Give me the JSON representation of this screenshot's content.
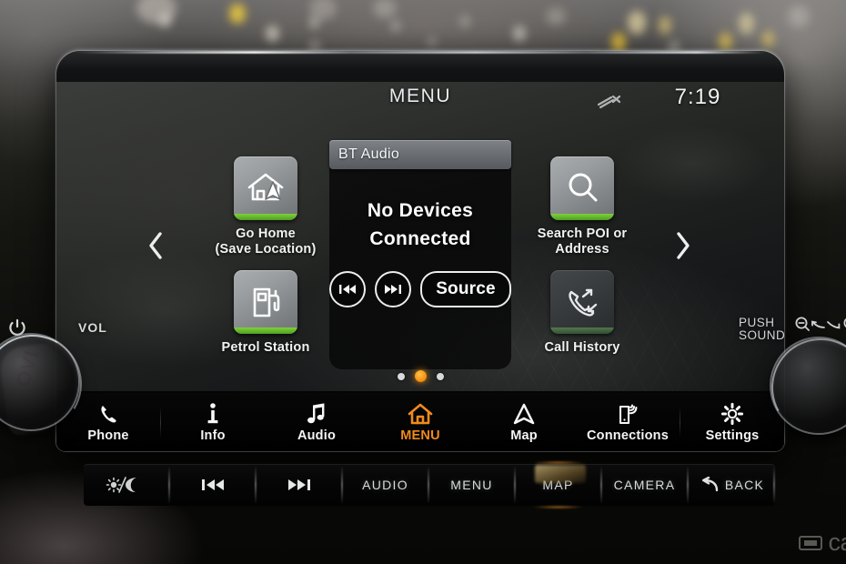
{
  "status_bar": {
    "title": "MENU",
    "mute_icon": "audio-muted-icon",
    "clock": "7:19"
  },
  "colors": {
    "accent_green": "#5CB82E",
    "active_orange": "#F08A1E",
    "tile_face": "#9A9EA1",
    "screen_bg": "#262826"
  },
  "tiles": {
    "left": [
      {
        "label": "Go Home\n(Save Location)",
        "label_line1": "Go Home",
        "label_line2": "(Save Location)",
        "icon": "home-with-arrow-icon",
        "state": "enabled"
      },
      {
        "label": "Petrol Station",
        "label_line1": "Petrol Station",
        "label_line2": "",
        "icon": "fuel-pump-icon",
        "state": "enabled"
      }
    ],
    "right": [
      {
        "label": "Search POI or Address",
        "label_line1": "Search POI or",
        "label_line2": "Address",
        "icon": "magnifier-icon",
        "state": "enabled"
      },
      {
        "label": "Call History",
        "label_line1": "Call History",
        "label_line2": "",
        "icon": "phone-call-history-icon",
        "state": "dimmed"
      }
    ]
  },
  "pager": {
    "prev_icon": "chevron-left-icon",
    "next_icon": "chevron-right-icon",
    "dots_total": 3,
    "dot_active_index": 1
  },
  "audio_panel": {
    "source_name": "BT Audio",
    "status_line1": "No Devices",
    "status_line2": "Connected",
    "prev_track_icon": "skip-previous-icon",
    "next_track_icon": "skip-next-icon",
    "source_button_label": "Source"
  },
  "nav_bar": {
    "items": [
      {
        "label": "Phone",
        "icon": "phone-handset-icon",
        "active": false
      },
      {
        "label": "Info",
        "icon": "info-i-icon",
        "active": false
      },
      {
        "label": "Audio",
        "icon": "music-note-icon",
        "active": false
      },
      {
        "label": "MENU",
        "icon": "home-outline-icon",
        "active": true
      },
      {
        "label": "Map",
        "icon": "navigation-arrow-icon",
        "active": false
      },
      {
        "label": "Connections",
        "icon": "phone-wireless-icon",
        "active": false
      },
      {
        "label": "Settings",
        "icon": "gear-icon",
        "active": false
      }
    ]
  },
  "hard_keys": [
    {
      "label": "",
      "icon": "brightness-day-night-icon"
    },
    {
      "label": "",
      "icon": "skip-previous-icon"
    },
    {
      "label": "",
      "icon": "skip-next-icon"
    },
    {
      "label": "AUDIO",
      "icon": ""
    },
    {
      "label": "MENU",
      "icon": ""
    },
    {
      "label": "MAP",
      "icon": ""
    },
    {
      "label": "CAMERA",
      "icon": ""
    },
    {
      "label": "BACK",
      "icon": "back-arrow-icon"
    }
  ],
  "knobs": {
    "left": {
      "power_icon": "power-icon",
      "label": "VOL"
    },
    "right": {
      "label_line1": "PUSH",
      "label_line2": "SOUND",
      "zoom_out_icon": "zoom-out-icon",
      "zoom_in_icon": "zoom-in-icon"
    }
  },
  "watermark": {
    "text": "ca",
    "icon": "car-badge-icon"
  }
}
